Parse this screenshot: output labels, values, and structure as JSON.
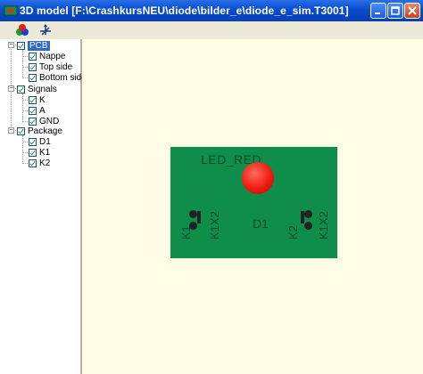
{
  "window": {
    "title": "3D model  [F:\\CrashkursNEU\\diode\\bilder_e\\diode_e_sim.T3001]",
    "minimize_glyph": "_",
    "maximize_glyph": "□",
    "close_glyph": "×",
    "accent": "#0a4fd0"
  },
  "toolbar": {
    "buttons": [
      {
        "icon": "rgb-color-balls-icon"
      },
      {
        "icon": "axes-icon"
      }
    ]
  },
  "tree": {
    "groups": [
      {
        "label": "PCB",
        "checked": true,
        "expanded": true,
        "selected": true,
        "children": [
          {
            "label": "Nappe",
            "checked": true
          },
          {
            "label": "Top side",
            "checked": true
          },
          {
            "label": "Bottom side",
            "checked": true
          }
        ]
      },
      {
        "label": "Signals",
        "checked": true,
        "expanded": true,
        "children": [
          {
            "label": "K",
            "checked": true
          },
          {
            "label": "A",
            "checked": true
          },
          {
            "label": "GND",
            "checked": true
          }
        ]
      },
      {
        "label": "Package",
        "checked": true,
        "expanded": true,
        "children": [
          {
            "label": "D1",
            "checked": true
          },
          {
            "label": "K1",
            "checked": true
          },
          {
            "label": "K2",
            "checked": true
          }
        ]
      }
    ],
    "expand_glyph": "−"
  },
  "viewport": {
    "background": "#fffce5",
    "board_color": "#0e8d4b",
    "led_color": "#f21a10",
    "labels": {
      "led": "LED_RED",
      "diode": "D1",
      "left_pad_a": "K1",
      "left_pad_b": "K1X2",
      "right_pad_a": "K2",
      "right_pad_b": "K1X2"
    }
  }
}
